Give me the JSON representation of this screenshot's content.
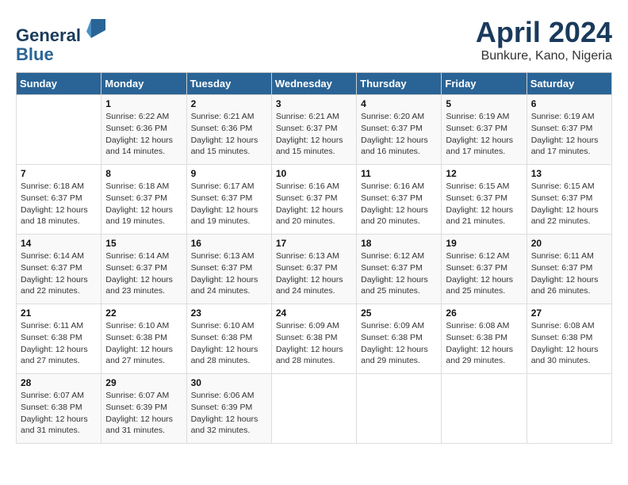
{
  "header": {
    "logo_line1": "General",
    "logo_line2": "Blue",
    "month": "April 2024",
    "location": "Bunkure, Kano, Nigeria"
  },
  "days_of_week": [
    "Sunday",
    "Monday",
    "Tuesday",
    "Wednesday",
    "Thursday",
    "Friday",
    "Saturday"
  ],
  "weeks": [
    [
      {
        "day": "",
        "sunrise": "",
        "sunset": "",
        "daylight": ""
      },
      {
        "day": "1",
        "sunrise": "6:22 AM",
        "sunset": "6:36 PM",
        "daylight": "12 hours and 14 minutes."
      },
      {
        "day": "2",
        "sunrise": "6:21 AM",
        "sunset": "6:36 PM",
        "daylight": "12 hours and 15 minutes."
      },
      {
        "day": "3",
        "sunrise": "6:21 AM",
        "sunset": "6:37 PM",
        "daylight": "12 hours and 15 minutes."
      },
      {
        "day": "4",
        "sunrise": "6:20 AM",
        "sunset": "6:37 PM",
        "daylight": "12 hours and 16 minutes."
      },
      {
        "day": "5",
        "sunrise": "6:19 AM",
        "sunset": "6:37 PM",
        "daylight": "12 hours and 17 minutes."
      },
      {
        "day": "6",
        "sunrise": "6:19 AM",
        "sunset": "6:37 PM",
        "daylight": "12 hours and 17 minutes."
      }
    ],
    [
      {
        "day": "7",
        "sunrise": "6:18 AM",
        "sunset": "6:37 PM",
        "daylight": "12 hours and 18 minutes."
      },
      {
        "day": "8",
        "sunrise": "6:18 AM",
        "sunset": "6:37 PM",
        "daylight": "12 hours and 19 minutes."
      },
      {
        "day": "9",
        "sunrise": "6:17 AM",
        "sunset": "6:37 PM",
        "daylight": "12 hours and 19 minutes."
      },
      {
        "day": "10",
        "sunrise": "6:16 AM",
        "sunset": "6:37 PM",
        "daylight": "12 hours and 20 minutes."
      },
      {
        "day": "11",
        "sunrise": "6:16 AM",
        "sunset": "6:37 PM",
        "daylight": "12 hours and 20 minutes."
      },
      {
        "day": "12",
        "sunrise": "6:15 AM",
        "sunset": "6:37 PM",
        "daylight": "12 hours and 21 minutes."
      },
      {
        "day": "13",
        "sunrise": "6:15 AM",
        "sunset": "6:37 PM",
        "daylight": "12 hours and 22 minutes."
      }
    ],
    [
      {
        "day": "14",
        "sunrise": "6:14 AM",
        "sunset": "6:37 PM",
        "daylight": "12 hours and 22 minutes."
      },
      {
        "day": "15",
        "sunrise": "6:14 AM",
        "sunset": "6:37 PM",
        "daylight": "12 hours and 23 minutes."
      },
      {
        "day": "16",
        "sunrise": "6:13 AM",
        "sunset": "6:37 PM",
        "daylight": "12 hours and 24 minutes."
      },
      {
        "day": "17",
        "sunrise": "6:13 AM",
        "sunset": "6:37 PM",
        "daylight": "12 hours and 24 minutes."
      },
      {
        "day": "18",
        "sunrise": "6:12 AM",
        "sunset": "6:37 PM",
        "daylight": "12 hours and 25 minutes."
      },
      {
        "day": "19",
        "sunrise": "6:12 AM",
        "sunset": "6:37 PM",
        "daylight": "12 hours and 25 minutes."
      },
      {
        "day": "20",
        "sunrise": "6:11 AM",
        "sunset": "6:37 PM",
        "daylight": "12 hours and 26 minutes."
      }
    ],
    [
      {
        "day": "21",
        "sunrise": "6:11 AM",
        "sunset": "6:38 PM",
        "daylight": "12 hours and 27 minutes."
      },
      {
        "day": "22",
        "sunrise": "6:10 AM",
        "sunset": "6:38 PM",
        "daylight": "12 hours and 27 minutes."
      },
      {
        "day": "23",
        "sunrise": "6:10 AM",
        "sunset": "6:38 PM",
        "daylight": "12 hours and 28 minutes."
      },
      {
        "day": "24",
        "sunrise": "6:09 AM",
        "sunset": "6:38 PM",
        "daylight": "12 hours and 28 minutes."
      },
      {
        "day": "25",
        "sunrise": "6:09 AM",
        "sunset": "6:38 PM",
        "daylight": "12 hours and 29 minutes."
      },
      {
        "day": "26",
        "sunrise": "6:08 AM",
        "sunset": "6:38 PM",
        "daylight": "12 hours and 29 minutes."
      },
      {
        "day": "27",
        "sunrise": "6:08 AM",
        "sunset": "6:38 PM",
        "daylight": "12 hours and 30 minutes."
      }
    ],
    [
      {
        "day": "28",
        "sunrise": "6:07 AM",
        "sunset": "6:38 PM",
        "daylight": "12 hours and 31 minutes."
      },
      {
        "day": "29",
        "sunrise": "6:07 AM",
        "sunset": "6:39 PM",
        "daylight": "12 hours and 31 minutes."
      },
      {
        "day": "30",
        "sunrise": "6:06 AM",
        "sunset": "6:39 PM",
        "daylight": "12 hours and 32 minutes."
      },
      {
        "day": "",
        "sunrise": "",
        "sunset": "",
        "daylight": ""
      },
      {
        "day": "",
        "sunrise": "",
        "sunset": "",
        "daylight": ""
      },
      {
        "day": "",
        "sunrise": "",
        "sunset": "",
        "daylight": ""
      },
      {
        "day": "",
        "sunrise": "",
        "sunset": "",
        "daylight": ""
      }
    ]
  ],
  "labels": {
    "sunrise": "Sunrise:",
    "sunset": "Sunset:",
    "daylight": "Daylight:"
  }
}
